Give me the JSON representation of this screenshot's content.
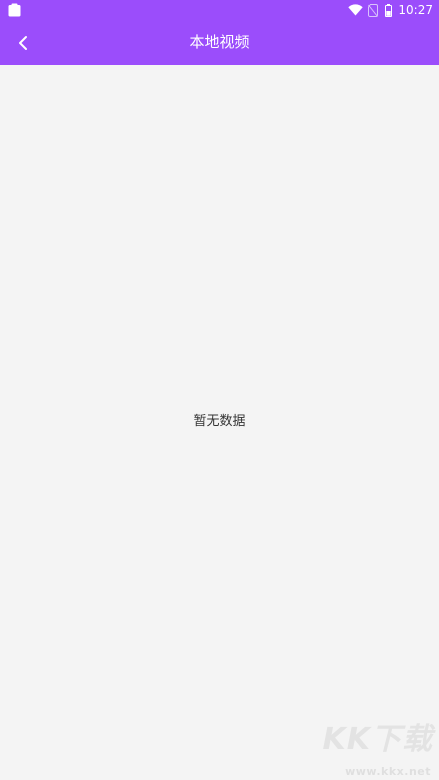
{
  "status_bar": {
    "time": "10:27",
    "icons": [
      "app-notification-icon",
      "wifi-icon",
      "no-sim-icon",
      "battery-icon"
    ]
  },
  "header": {
    "title": "本地视频",
    "back_icon": "chevron-left-icon",
    "background_color": "#9b4dfb"
  },
  "content": {
    "empty_text": "暂无数据",
    "background_color": "#f4f4f4"
  },
  "watermark": {
    "logo": "KK下载",
    "url": "www.kkx.net"
  }
}
